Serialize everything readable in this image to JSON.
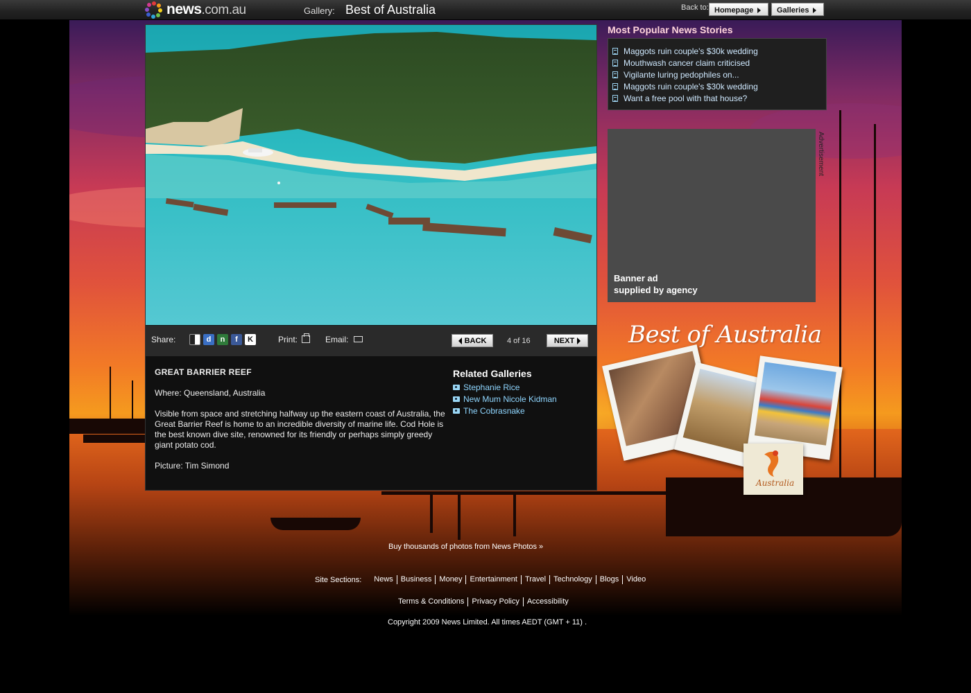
{
  "header": {
    "logo_text": "news",
    "logo_domain": ".com.au",
    "gallery_label": "Gallery:",
    "gallery_title": "Best of Australia",
    "back_to_label": "Back to:",
    "homepage_button": "Homepage",
    "galleries_button": "Galleries"
  },
  "photo": {
    "share_label": "Share:",
    "share_services": [
      "del.icio.us",
      "digg",
      "newsvine",
      "facebook",
      "kwoff"
    ],
    "print_label": "Print:",
    "email_label": "Email:",
    "back_button": "BACK",
    "next_button": "NEXT",
    "counter": "4 of 16"
  },
  "caption": {
    "title": "GREAT BARRIER REEF",
    "where": "Where: Queensland, Australia",
    "body": "Visible from space and stretching halfway up the eastern coast of Australia, the Great Barrier Reef is home to an incredible diversity of marine life. Cod  Hole is the best known dive site, renowned for its friendly or perhaps simply greedy giant potato cod.",
    "credit": "Picture: Tim Simond"
  },
  "related": {
    "title": "Related Galleries",
    "items": [
      "Stephanie Rice",
      "New Mum Nicole Kidman",
      "The Cobrasnake"
    ]
  },
  "popular": {
    "title": "Most Popular News Stories",
    "items": [
      "Maggots ruin couple's $30k wedding",
      "Mouthwash cancer claim criticised",
      "Vigilante luring pedophiles on...",
      "Maggots ruin couple's $30k wedding",
      "Want a free pool with that house?"
    ]
  },
  "ad": {
    "text_line1": "Banner ad",
    "text_line2": "supplied by agency",
    "vertical_label": "Advertisement"
  },
  "promo": {
    "title": "Best of Australia",
    "logo_text": "Australia"
  },
  "footer": {
    "buy_link": "Buy thousands of photos from News Photos »",
    "site_sections_label": "Site Sections:",
    "site_sections": [
      "News",
      "Business",
      "Money",
      "Entertainment",
      "Travel",
      "Technology",
      "Blogs",
      "Video"
    ],
    "legal": [
      "Terms & Conditions",
      "Privacy Policy",
      "Accessibility"
    ],
    "copyright": "Copyright 2009 News Limited. All times AEDT (GMT + 11) ."
  },
  "colors": {
    "related_link": "#8fd6ff",
    "popular_title": "#ffd4dc",
    "panel_bg": "#101010",
    "ad_bg": "#4a4a4a"
  }
}
